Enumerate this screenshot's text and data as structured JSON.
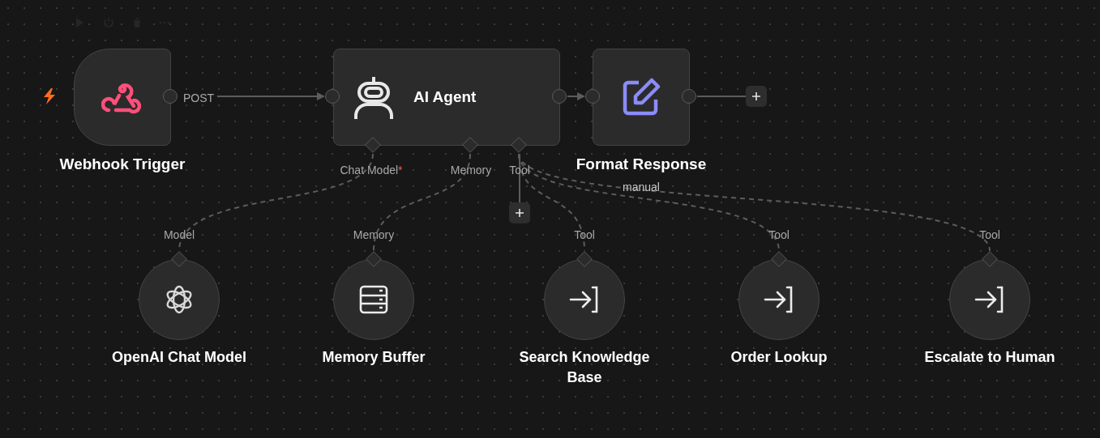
{
  "nodes": [
    {
      "kind": "trigger",
      "name": "Webhook Trigger",
      "output_label": "POST"
    },
    {
      "kind": "agent",
      "name": "AI Agent",
      "inputs": [
        {
          "label": "Chat Model",
          "mark": "*"
        },
        {
          "label": "Memory"
        },
        {
          "label": "Tool"
        }
      ]
    },
    {
      "kind": "action",
      "name": "Format Response",
      "subtitle": "manual"
    }
  ],
  "sub_nodes": [
    {
      "kind": "model",
      "name": "OpenAI Chat Model",
      "port_label": "Model"
    },
    {
      "kind": "memory",
      "name": "Memory Buffer",
      "port_label": "Memory"
    },
    {
      "kind": "tool",
      "name": "Search Knowledge Base",
      "port_label": "Tool"
    },
    {
      "kind": "tool",
      "name": "Order Lookup",
      "port_label": "Tool"
    },
    {
      "kind": "tool",
      "name": "Escalate to Human",
      "port_label": "Tool"
    }
  ]
}
